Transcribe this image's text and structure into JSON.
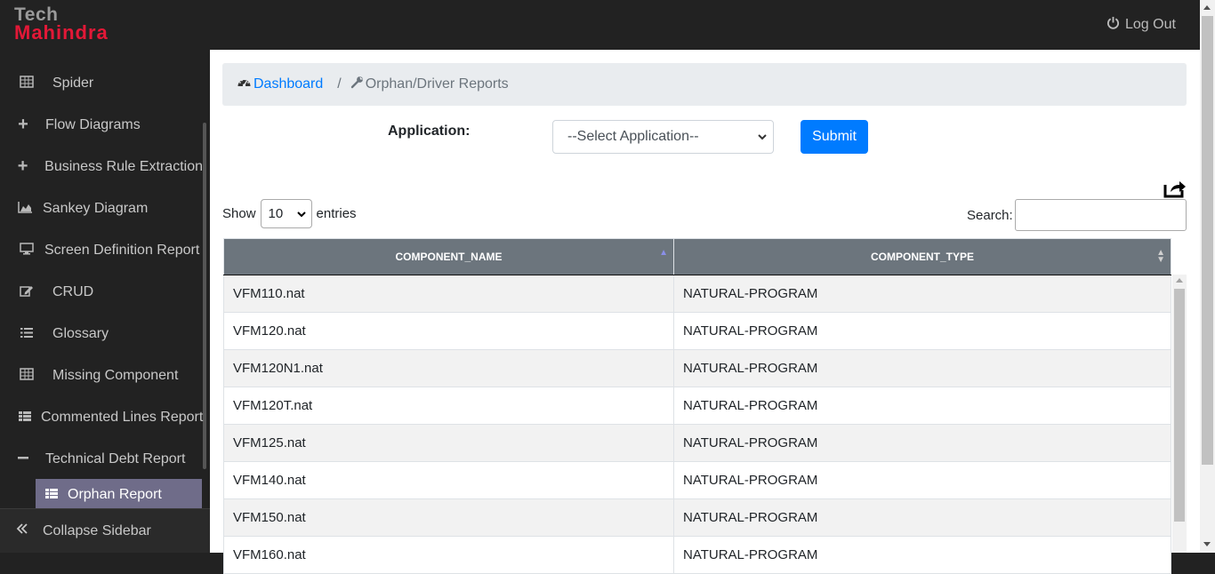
{
  "brand": {
    "line1": "Tech",
    "line2": "Mahindra"
  },
  "header": {
    "logout_label": "Log Out"
  },
  "sidebar": {
    "items": [
      {
        "label": "Spider",
        "icon": "table-icon"
      },
      {
        "label": "Flow Diagrams",
        "icon": "plus-icon"
      },
      {
        "label": "Business Rule Extraction",
        "icon": "plus-icon"
      },
      {
        "label": "Sankey Diagram",
        "icon": "area-chart-icon"
      },
      {
        "label": "Screen Definition Report",
        "icon": "desktop-icon"
      },
      {
        "label": "CRUD",
        "icon": "edit-icon"
      },
      {
        "label": "Glossary",
        "icon": "list-icon"
      },
      {
        "label": "Missing Component",
        "icon": "table-icon"
      },
      {
        "label": "Commented Lines Report",
        "icon": "th-list-icon"
      },
      {
        "label": "Technical Debt Report",
        "icon": "minus-icon"
      }
    ],
    "subitem": {
      "label": "Orphan Report",
      "icon": "th-list-icon"
    },
    "collapse_label": "Collapse Sidebar"
  },
  "breadcrumb": {
    "home": "Dashboard",
    "separator": "/",
    "current": "Orphan/Driver Reports"
  },
  "form": {
    "application_label": "Application:",
    "application_selected": "--Select Application--",
    "submit_label": "Submit"
  },
  "table_controls": {
    "show_label": "Show",
    "entries_value": "10",
    "entries_label": "entries",
    "search_label": "Search:"
  },
  "table": {
    "headers": [
      "COMPONENT_NAME",
      "COMPONENT_TYPE"
    ],
    "rows": [
      [
        "VFM110.nat",
        "NATURAL-PROGRAM"
      ],
      [
        "VFM120.nat",
        "NATURAL-PROGRAM"
      ],
      [
        "VFM120N1.nat",
        "NATURAL-PROGRAM"
      ],
      [
        "VFM120T.nat",
        "NATURAL-PROGRAM"
      ],
      [
        "VFM125.nat",
        "NATURAL-PROGRAM"
      ],
      [
        "VFM140.nat",
        "NATURAL-PROGRAM"
      ],
      [
        "VFM150.nat",
        "NATURAL-PROGRAM"
      ],
      [
        "VFM160.nat",
        "NATURAL-PROGRAM"
      ]
    ]
  },
  "colors": {
    "topbar": "#222222",
    "brand_red": "#e31837",
    "accent_blue": "#007bff",
    "active_sub": "#6f6c89",
    "table_header": "#6c757d"
  }
}
